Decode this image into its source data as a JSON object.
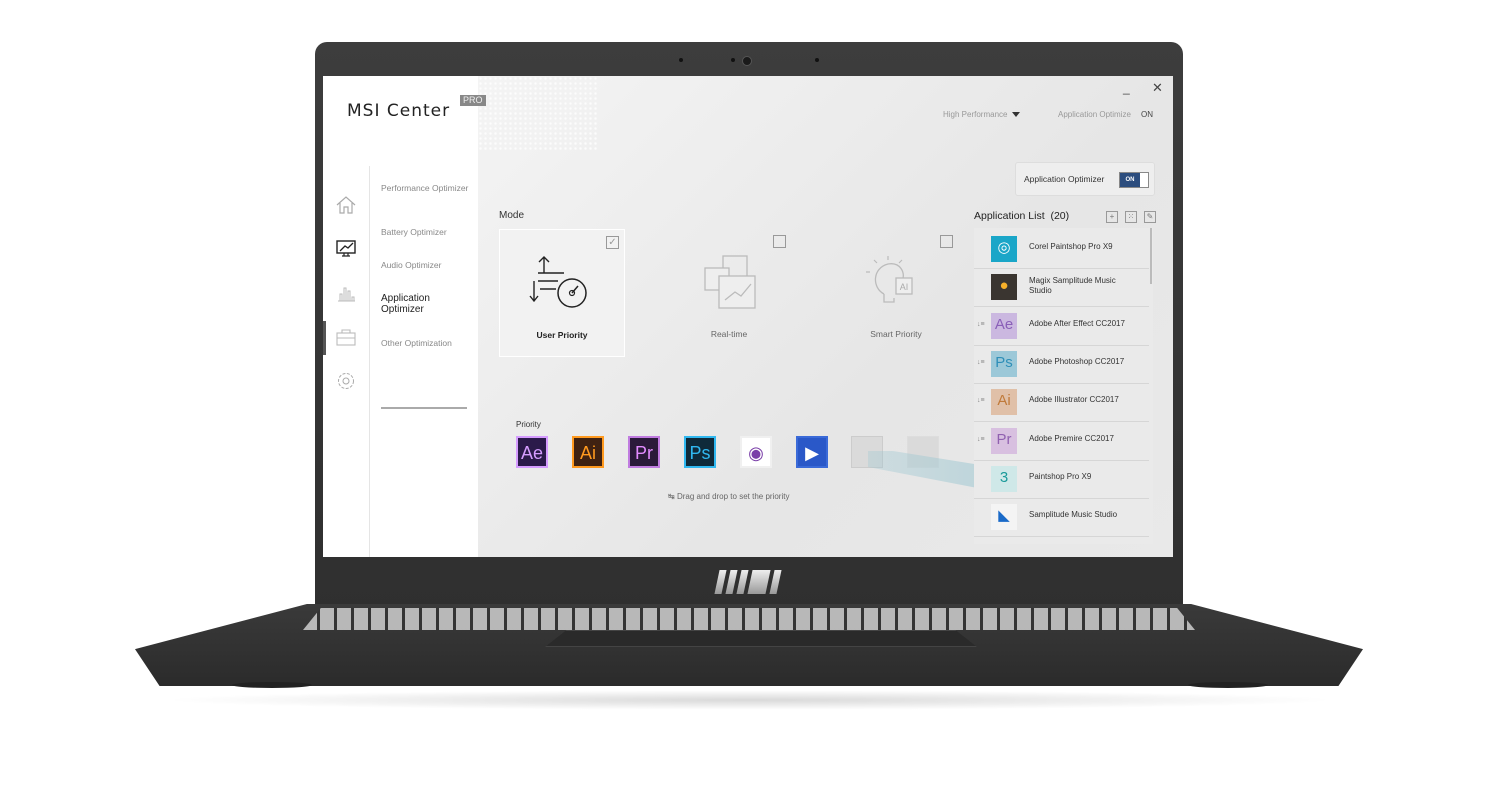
{
  "app": {
    "title": "MSI Center",
    "badge": "PRO",
    "window_controls": {
      "minimize": "_",
      "close": "✕"
    },
    "top_bar": {
      "mode_select": "High Performance",
      "status_label": "Application Optimize",
      "status_value": "ON"
    }
  },
  "rail": {
    "icons": [
      "home-icon",
      "performance-monitor-icon",
      "bar-chart-icon",
      "toolbox-icon",
      "gear-icon"
    ],
    "active_index": 1
  },
  "menu": {
    "items": [
      {
        "label": "Performance Optimizer"
      },
      {
        "label": "Battery Optimizer"
      },
      {
        "label": "Audio Optimizer"
      },
      {
        "label": "Application Optimizer",
        "active": true
      },
      {
        "label": "Other Optimization"
      }
    ]
  },
  "optimizer_toggle": {
    "label": "Application Optimizer",
    "state": "ON"
  },
  "mode": {
    "label": "Mode",
    "options": [
      {
        "name": "User Priority",
        "checked": true,
        "icon": "user-priority-gauge-icon"
      },
      {
        "name": "Real-time",
        "checked": false,
        "icon": "real-time-windows-icon"
      },
      {
        "name": "Smart Priority",
        "checked": false,
        "icon": "ai-lightbulb-icon"
      }
    ]
  },
  "priority": {
    "label": "Priority",
    "apps": [
      {
        "abbr": "Ae",
        "bg": "#2b1a4a",
        "fg": "#d59cff",
        "border": "#d59cff"
      },
      {
        "abbr": "Ai",
        "bg": "#3f2212",
        "fg": "#ff9a1f",
        "border": "#ff9a1f"
      },
      {
        "abbr": "Pr",
        "bg": "#2b1a3a",
        "fg": "#e28bff",
        "border": "#c07ce0"
      },
      {
        "abbr": "Ps",
        "bg": "#0f2a3a",
        "fg": "#30b8f0",
        "border": "#30b8f0"
      },
      {
        "abbr": "◉",
        "bg": "#ffffff",
        "fg": "#7a3ea8",
        "border": "#f0f0f0"
      },
      {
        "abbr": "▶",
        "bg": "#2a58c8",
        "fg": "#ffffff",
        "border": "#3a6ad8"
      }
    ],
    "empty_slots": 2,
    "hint": "Drag and drop to set the priority"
  },
  "application_list": {
    "title": "Application List",
    "count": "(20)",
    "actions": [
      "add-icon",
      "select-icon",
      "edit-icon"
    ],
    "items": [
      {
        "name": "Corel Paintshop Pro X9",
        "abbr": "◎",
        "bg": "#1aa6c8",
        "fg": "#ffffff",
        "sorted": false
      },
      {
        "name": "Magix Samplitude Music Studio",
        "abbr": "●",
        "bg": "#3a3530",
        "fg": "#f6b02a",
        "sorted": false
      },
      {
        "name": "Adobe After Effect CC2017",
        "abbr": "Ae",
        "bg": "#cbb8e0",
        "fg": "#8a5fb8",
        "sorted": true
      },
      {
        "name": "Adobe Photoshop CC2017",
        "abbr": "Ps",
        "bg": "#9cc8d8",
        "fg": "#2f8fb8",
        "sorted": true
      },
      {
        "name": "Adobe Illustrator CC2017",
        "abbr": "Ai",
        "bg": "#e0c0a8",
        "fg": "#c07a3a",
        "sorted": true
      },
      {
        "name": "Adobe Premire CC2017",
        "abbr": "Pr",
        "bg": "#d8c0e0",
        "fg": "#9060b0",
        "sorted": true
      },
      {
        "name": "Paintshop Pro X9",
        "abbr": "3",
        "bg": "#cfe8e8",
        "fg": "#1a9a9a",
        "sorted": false
      },
      {
        "name": "Samplitude Music Studio",
        "abbr": "◣",
        "bg": "#f4f4f4",
        "fg": "#1a6ac8",
        "sorted": false
      }
    ]
  }
}
